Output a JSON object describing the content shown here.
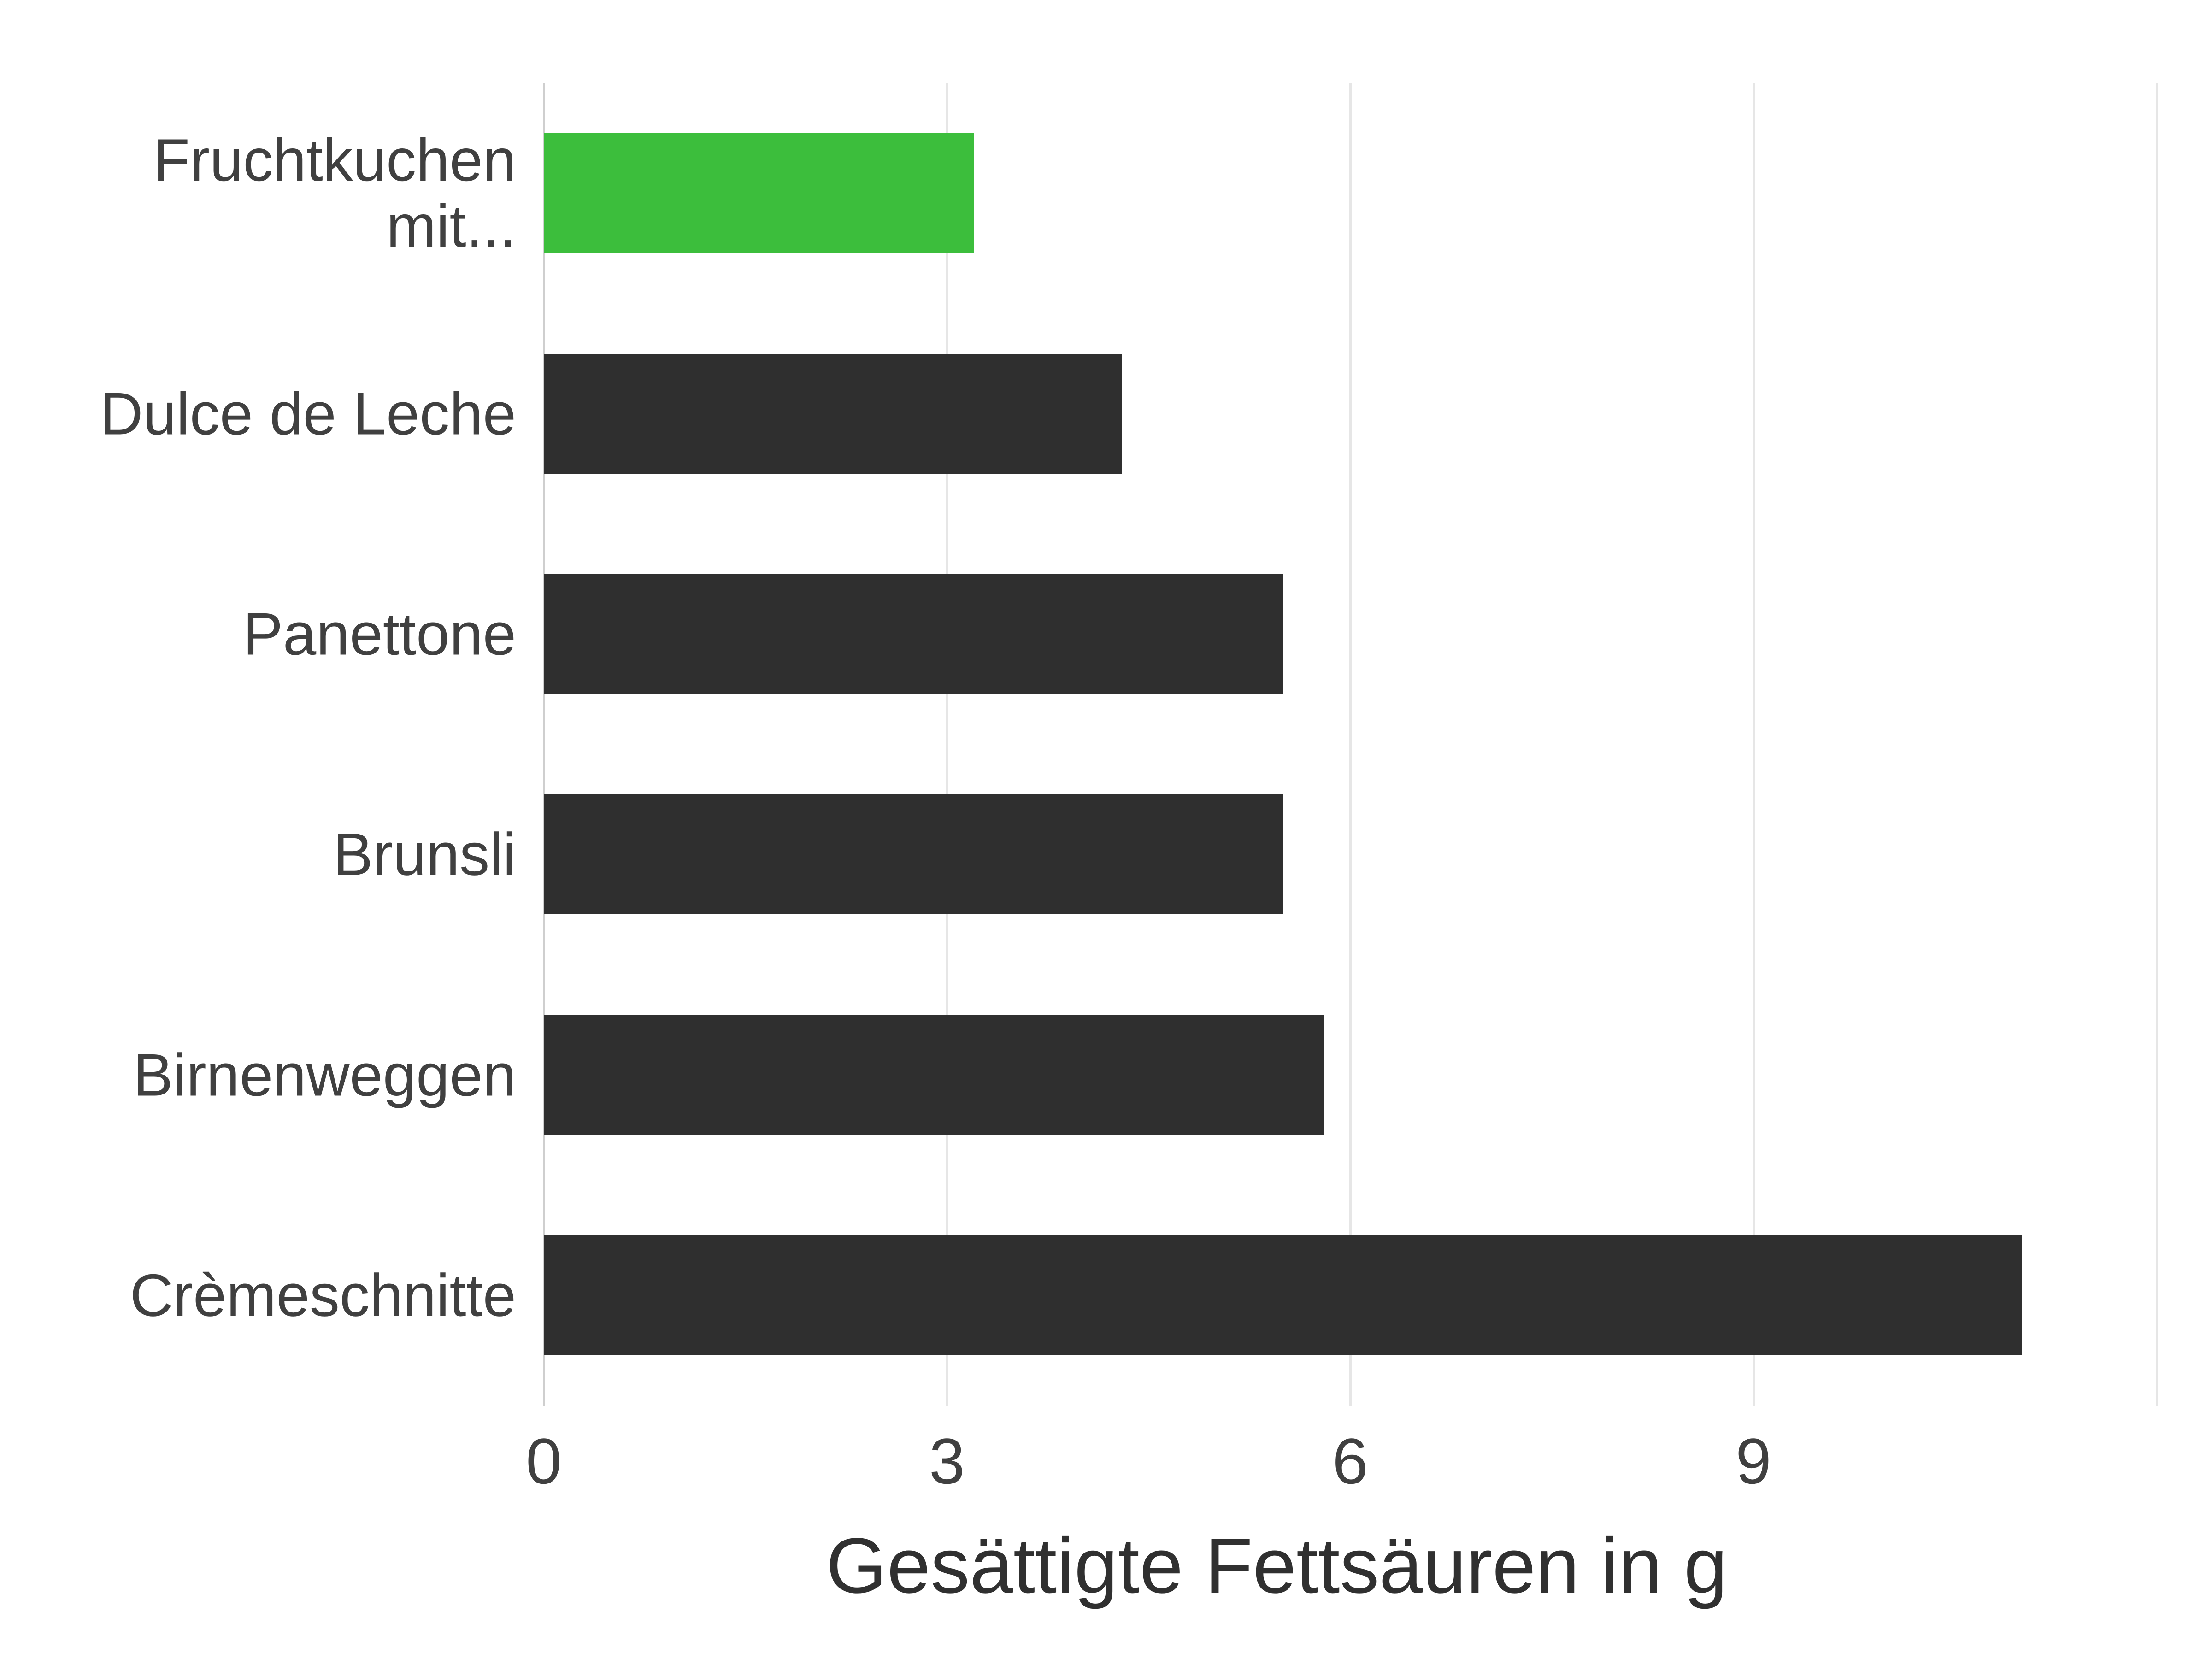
{
  "chart_data": {
    "type": "bar",
    "orientation": "horizontal",
    "categories": [
      "Fruchtkuchen mit...",
      "Dulce de Leche",
      "Panettone",
      "Brunsli",
      "Birnenweggen",
      "Crèmeschnitte"
    ],
    "values": [
      3.2,
      4.3,
      5.5,
      5.5,
      5.8,
      11.0
    ],
    "highlight_index": 0,
    "xlabel": "Gesättigte Fettsäuren in g",
    "ylabel": "",
    "title": "",
    "xlim": [
      0,
      12
    ],
    "xticks": [
      0,
      3,
      6,
      9
    ],
    "colors": {
      "default": "#2f2f2f",
      "highlight": "#3cbe3c"
    }
  }
}
